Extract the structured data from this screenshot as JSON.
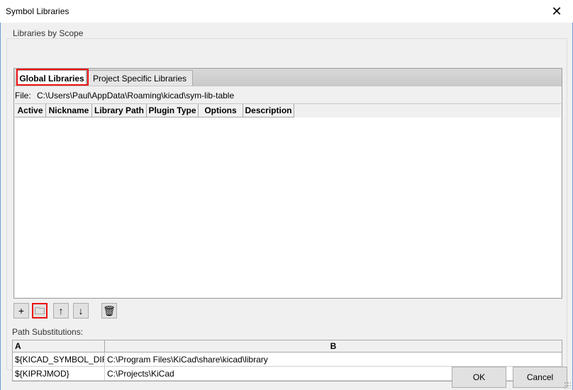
{
  "window": {
    "title": "Symbol Libraries"
  },
  "group": {
    "label": "Libraries by Scope"
  },
  "tabs": [
    {
      "label": "Global Libraries",
      "active": true
    },
    {
      "label": "Project Specific Libraries",
      "active": false
    }
  ],
  "file": {
    "label": "File:",
    "path": "C:\\Users\\Paul\\AppData\\Roaming\\kicad\\sym-lib-table"
  },
  "library_table": {
    "columns": [
      "Active",
      "Nickname",
      "Library Path",
      "Plugin Type",
      "Options",
      "Description"
    ],
    "rows": []
  },
  "toolbar": {
    "buttons": [
      {
        "name": "add",
        "icon": "plus-icon",
        "glyph": "+"
      },
      {
        "name": "browse",
        "icon": "folder-icon",
        "glyph": "🗀"
      },
      {
        "name": "move-up",
        "icon": "arrow-up-icon",
        "glyph": "↑"
      },
      {
        "name": "move-down",
        "icon": "arrow-down-icon",
        "glyph": "↓"
      },
      {
        "name": "delete",
        "icon": "trash-icon",
        "glyph": "🗑"
      }
    ]
  },
  "path_substitutions": {
    "label": "Path Substitutions:",
    "columns": [
      "A",
      "B"
    ],
    "rows": [
      {
        "a": "${KICAD_SYMBOL_DIR}",
        "b": "C:\\Program Files\\KiCad\\share\\kicad\\library"
      },
      {
        "a": "${KIPRJMOD}",
        "b": "C:\\Projects\\KiCad"
      }
    ]
  },
  "buttons": {
    "ok": "OK",
    "cancel": "Cancel"
  },
  "colors": {
    "highlight": "#ee1111",
    "titlebar": "#ffffff",
    "dialog_bg": "#f0f0f0"
  }
}
